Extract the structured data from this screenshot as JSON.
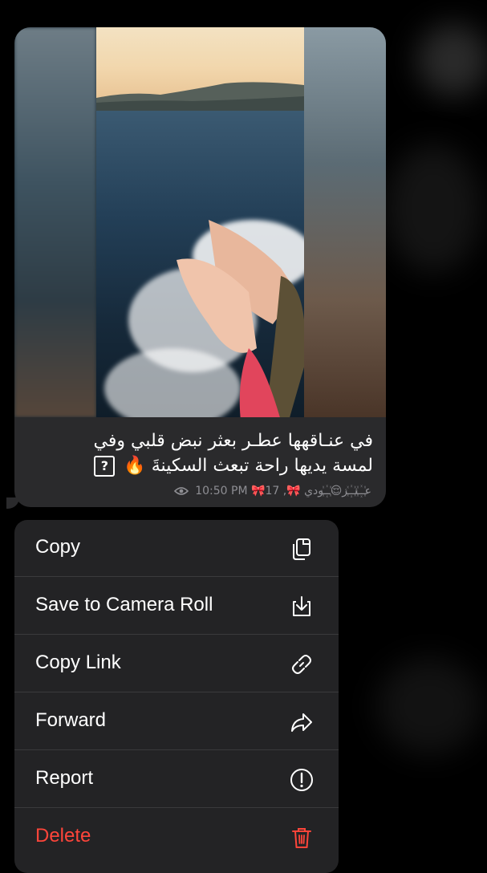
{
  "message": {
    "caption_lines": [
      "في عنـاقهها عطـر بعثر نبض قلبي وفي",
      "لمسة يديها راحة تبعث السكينةَ 🔥"
    ],
    "caption_badge": "?",
    "meta": {
      "views": "17",
      "reactions": "🎀عـ꙰ـنـ꙰ـز😌ـ꙰ـودي 🎀,",
      "time": "10:50 PM"
    }
  },
  "context_menu": {
    "items": [
      {
        "label": "Copy",
        "icon": "copy-icon",
        "style": "normal"
      },
      {
        "label": "Save to Camera Roll",
        "icon": "download-icon",
        "style": "normal"
      },
      {
        "label": "Copy Link",
        "icon": "link-icon",
        "style": "normal"
      },
      {
        "label": "Forward",
        "icon": "forward-icon",
        "style": "normal"
      },
      {
        "label": "Report",
        "icon": "exclamation-icon",
        "style": "normal"
      },
      {
        "label": "Delete",
        "icon": "trash-icon",
        "style": "destructive"
      }
    ]
  },
  "colors": {
    "background": "#000000",
    "bubble": "#2a2a2c",
    "menu": "#232325",
    "destructive": "#ff453a",
    "meta_text": "#8e8e93"
  }
}
